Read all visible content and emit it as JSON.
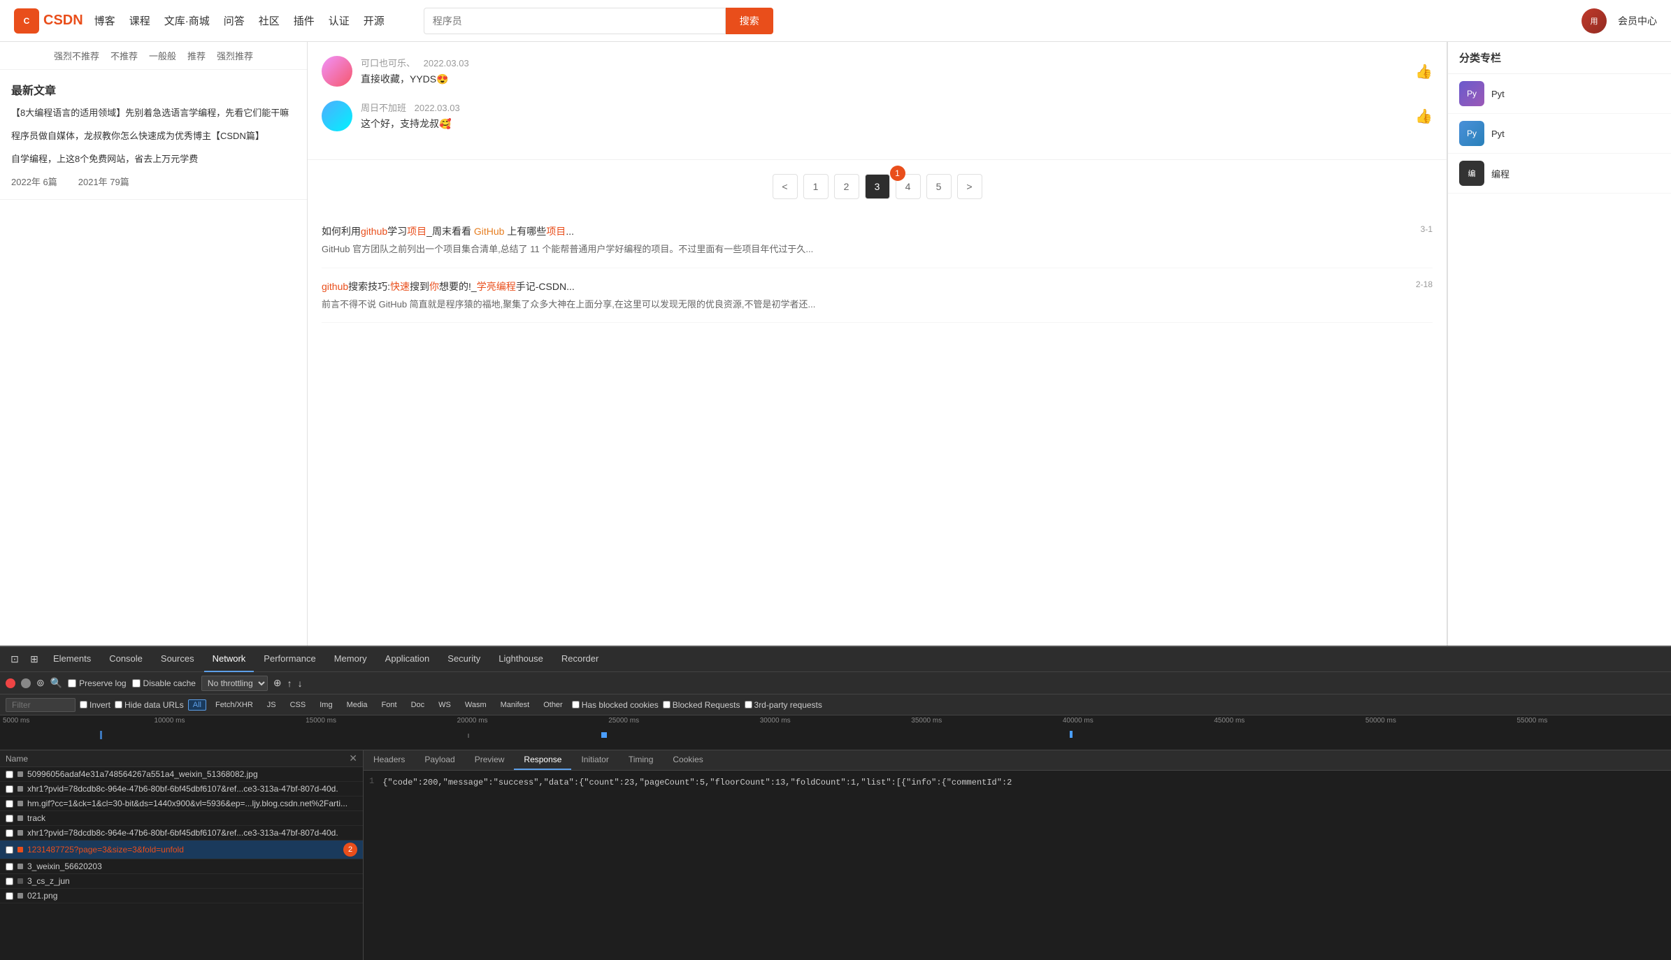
{
  "nav": {
    "logo_text": "CSDN",
    "items": [
      "博客",
      "课程",
      "文库·商城",
      "问答",
      "社区",
      "插件",
      "认证",
      "开源"
    ],
    "search_placeholder": "程序员",
    "search_btn": "搜索",
    "member": "会员中心"
  },
  "rating": {
    "items": [
      "强烈不推荐",
      "不推荐",
      "一般般",
      "推荐",
      "强烈推荐"
    ]
  },
  "latest_articles": {
    "title": "最新文章",
    "articles": [
      "【8大编程语言的适用领域】先别着急选语言学编程，先看它们能干嘛",
      "程序员做自媒体，龙叔教你怎么快速成为优秀博主【CSDN篇】",
      "自学编程，上这8个免费网站，省去上万元学费"
    ],
    "stats": [
      {
        "year": "2022年",
        "count": "6篇"
      },
      {
        "year": "2021年",
        "count": "79篇"
      }
    ]
  },
  "comments": [
    {
      "user": "可口也可乐、",
      "date": "2022.03.03",
      "text": "直接收藏，YYDS😍"
    },
    {
      "user": "周日不加班",
      "date": "2022.03.03",
      "text": "这个好，支持龙叔🥰"
    }
  ],
  "pagination": {
    "prev": "<",
    "pages": [
      "1",
      "2",
      "3",
      "4",
      "5"
    ],
    "next": ">",
    "active": "3",
    "badge": "1"
  },
  "search_results": [
    {
      "id": "result-1",
      "title": "如何利用github学习项目_周末看看 GitHub 上有哪些项目...",
      "title_parts": {
        "normal1": "如何利用",
        "red1": "github",
        "normal2": "学习",
        "red2": "项目",
        "normal3": "_周末看看 ",
        "orange1": "GitHub",
        "normal4": " 上有哪些",
        "red3": "项目",
        "normal5": "..."
      },
      "num": "3-1",
      "desc": "GitHub 官方团队之前列出一个项目集合清单,总结了 11 个能帮普通用户学好编程的项目。不过里面有一些项目年代过于久..."
    },
    {
      "id": "result-2",
      "title": "github搜索技巧:快速搜到你想要的!_学亮编程手记-CSDN...",
      "num": "2-18",
      "desc": "前言不得不说 GitHub 简直就是程序猿的福地,聚集了众多大神在上面分享,在这里可以发现无限的优良资源,不管是初学者还..."
    }
  ],
  "right_sidebar": {
    "title": "分类专栏",
    "items": [
      {
        "label": "Pyt",
        "color": "#6a5acd"
      },
      {
        "label": "Pyt",
        "color": "#4a90d9"
      },
      {
        "label": "编程",
        "color": "#333"
      }
    ]
  },
  "devtools": {
    "tabs": [
      "Elements",
      "Console",
      "Sources",
      "Network",
      "Performance",
      "Memory",
      "Application",
      "Security",
      "Lighthouse",
      "Recorder"
    ],
    "active_tab": "Network",
    "toolbar": {
      "preserve_log": "Preserve log",
      "disable_cache": "Disable cache",
      "throttle": "No throttling"
    },
    "filter": {
      "placeholder": "Filter",
      "invert": "Invert",
      "hide_urls": "Hide data URLs",
      "buttons": [
        "All",
        "Fetch/XHR",
        "JS",
        "CSS",
        "Img",
        "Media",
        "Font",
        "Doc",
        "WS",
        "Wasm",
        "Manifest",
        "Other"
      ],
      "active_btn": "All",
      "has_blocked": "Has blocked cookies",
      "blocked_requests": "Blocked Requests",
      "third_party": "3rd-party requests"
    },
    "timeline_labels": [
      "5000 ms",
      "10000 ms",
      "15000 ms",
      "20000 ms",
      "25000 ms",
      "30000 ms",
      "35000 ms",
      "40000 ms",
      "45000 ms",
      "50000 ms",
      "55000 ms"
    ],
    "response_tabs": [
      "Headers",
      "Payload",
      "Preview",
      "Response",
      "Initiator",
      "Timing",
      "Cookies"
    ],
    "active_response_tab": "Response",
    "response_line": "{\"code\":200,\"message\":\"success\",\"data\":{\"count\":23,\"pageCount\":5,\"floorCount\":13,\"foldCount\":1,\"list\":[{\"info\":{\"commentId\":2",
    "files": [
      {
        "name": "50996056adaf4e31a748564267a551a4_weixin_51368082.jpg",
        "color": "#555",
        "selected": false
      },
      {
        "name": "xhr1?pvid=78dcdb8c-964e-47b6-80bf-6bf45dbf6107&ref...ce3-313a-47bf-807d-40d.",
        "color": "#555",
        "selected": false
      },
      {
        "name": "hm.gif?cc=1&ck=1&cl=30-bit&ds=1440x900&vl=5936&ep=...ljy.blog.csdn.net%2Farti...",
        "color": "#555",
        "selected": false
      },
      {
        "name": "track",
        "color": "#555",
        "selected": false
      },
      {
        "name": "xhr1?pvid=78dcdb8c-964e-47b6-80bf-6bf45dbf6107&ref...ce3-313a-47bf-807d-40d.",
        "color": "#555",
        "selected": false
      },
      {
        "name": "1231487725?page=3&size=3&fold=unfold",
        "color": "#e94e1b",
        "selected": true,
        "badge": "2"
      },
      {
        "name": "3_weixin_56620203",
        "color": "#555",
        "selected": false
      },
      {
        "name": "3_cs_z_jun",
        "color": "#555",
        "selected": false
      },
      {
        "name": "021.png",
        "color": "#555",
        "selected": false
      }
    ]
  }
}
